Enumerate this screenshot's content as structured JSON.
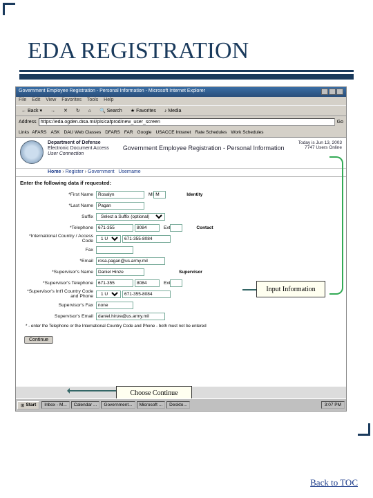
{
  "slide_title": "EDA REGISTRATION",
  "browser": {
    "window_title": "Government Employee Registration - Personal Information - Microsoft Internet Explorer",
    "menu": [
      "File",
      "Edit",
      "View",
      "Favorites",
      "Tools",
      "Help"
    ],
    "toolbar": {
      "back": "Back",
      "search": "Search",
      "favorites": "Favorites",
      "media": "Media"
    },
    "address_label": "Address",
    "address_value": "https://eda.ogden.disa.mil/pls/cafprod/new_user_screen",
    "go": "Go",
    "links_label": "Links",
    "links": [
      "AFARS",
      "ASK",
      "DAU Web Classes",
      "DFARS",
      "FAR",
      "Google",
      "USACCE Intranet",
      "Rate Schedules",
      "Work Schedules"
    ]
  },
  "page": {
    "dept": "Department of Defense",
    "app": "Electronic Document Access",
    "sub": "User Connection",
    "title": "Government Employee Registration - Personal Information",
    "today": "Today is Jun 13, 2003",
    "users": "7747 Users Online",
    "breadcrumb": [
      "Home",
      "Register",
      "Government",
      "Username"
    ],
    "instruction": "Enter the following data if requested:"
  },
  "form": {
    "first_name_lbl": "*First Name",
    "first_name": "Rosalyn",
    "mi_lbl": "MI",
    "mi": "M",
    "last_name_lbl": "*Last Name",
    "last_name": "Pagan",
    "suffix_lbl": "Suffix",
    "suffix": "Select a Suffix (optional)",
    "phone_lbl": "*Telephone",
    "phone1": "671-355",
    "phone2": "8084",
    "ext_lbl": "Ext",
    "acc_lbl": "*International Country / Access Code",
    "acc1": "1 US",
    "acc2": "671-355-8084",
    "fax_lbl": "Fax",
    "email_lbl": "*Email",
    "email": "rosa.pagan@us.army.mil",
    "sup_name_lbl": "*Supervisor's Name",
    "sup_name": "Daniel Hinze",
    "sup_phone_lbl": "*Supervisor's Telephone",
    "sup_phone1": "671-355",
    "sup_phone2": "8084",
    "sup_acc_lbl": "*Supervisor's Int'l Country Code and Phone",
    "sup_acc1": "1 US",
    "sup_acc2": "671-355-8084",
    "sup_fax_lbl": "Supervisor's Fax",
    "sup_fax": "none",
    "sup_email_lbl": "Supervisor's Email",
    "sup_email": "daniel.hinze@us.army.mil",
    "note": "* - enter the Telephone or the International Country Code and Phone - both must not be entered",
    "continue": "Continue",
    "identity_lbl": "Identity",
    "contact_lbl": "Contact",
    "supervisor_lbl": "Supervisor"
  },
  "callouts": {
    "input": "Input Information",
    "continue": "Choose Continue"
  },
  "taskbar": {
    "start": "Start",
    "items": [
      "Inbox - M...",
      "Calendar ...",
      "Government...",
      "Microsoft ...",
      "Deskto..."
    ],
    "time": "3:07 PM"
  },
  "footer_link": "Back to TOC"
}
